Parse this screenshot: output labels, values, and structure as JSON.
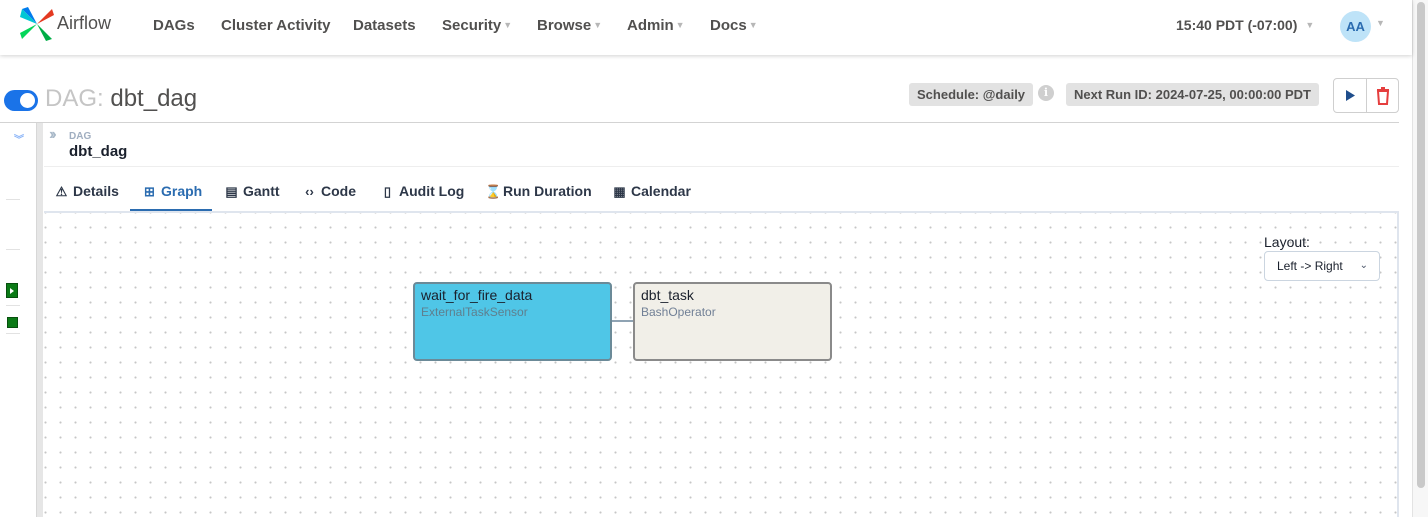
{
  "navbar": {
    "brand": "Airflow",
    "items": [
      "DAGs",
      "Cluster Activity",
      "Datasets",
      "Security",
      "Browse",
      "Admin",
      "Docs"
    ],
    "clock": "15:40 PDT (-07:00)",
    "avatar_initials": "AA"
  },
  "dag_header": {
    "prefix": "DAG:",
    "dag_id": "dbt_dag",
    "schedule_chip": "Schedule: @daily",
    "next_run_chip": "Next Run ID: 2024-07-25, 00:00:00 PDT",
    "paused": false
  },
  "breadcrumb": {
    "label": "DAG",
    "value": "dbt_dag"
  },
  "tabs": [
    {
      "label": "Details",
      "icon": "warning-icon"
    },
    {
      "label": "Graph",
      "icon": "graph-icon",
      "active": true
    },
    {
      "label": "Gantt",
      "icon": "gantt-icon"
    },
    {
      "label": "Code",
      "icon": "code-icon"
    },
    {
      "label": "Audit Log",
      "icon": "audit-log-icon"
    },
    {
      "label": "Run Duration",
      "icon": "hourglass-icon"
    },
    {
      "label": "Calendar",
      "icon": "calendar-icon"
    }
  ],
  "graph": {
    "layout_label": "Layout:",
    "layout_value": "Left -> Right",
    "nodes": [
      {
        "name": "wait_for_fire_data",
        "type": "ExternalTaskSensor",
        "color": "#4fc6e7"
      },
      {
        "name": "dbt_task",
        "type": "BashOperator",
        "color": "#f1efe8"
      }
    ]
  },
  "colors": {
    "accent": "#2b6cb0",
    "toggle_on": "#1a73e8",
    "success": "#0b7a16",
    "delete": "#e53e3e"
  }
}
